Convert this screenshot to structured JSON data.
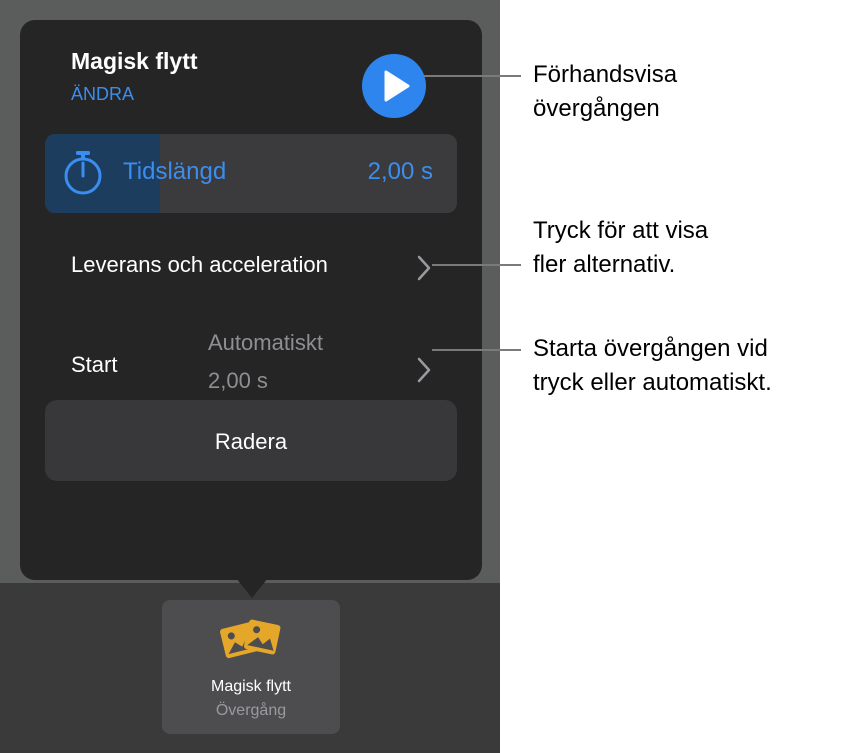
{
  "popover": {
    "title": "Magisk flytt",
    "change_label": "ÄNDRA",
    "play_icon": "play-icon",
    "duration": {
      "icon": "stopwatch-icon",
      "label": "Tidslängd",
      "value": "2,00 s",
      "fill_fraction": 0.28
    },
    "delivery": {
      "label": "Leverans och acceleration",
      "icon": "chevron-right-icon"
    },
    "start": {
      "label": "Start",
      "value_line1": "Automatiskt",
      "value_line2": "2,00 s",
      "icon": "chevron-right-icon"
    },
    "delete_label": "Radera"
  },
  "bottom_bar": {
    "thumb_icon": "photos-icon",
    "thumb_title": "Magisk flytt",
    "thumb_subtitle": "Övergång"
  },
  "callouts": [
    {
      "lines": [
        "Förhandsvisa",
        "övergången"
      ]
    },
    {
      "lines": [
        "Tryck för att visa",
        "fler alternativ."
      ]
    },
    {
      "lines": [
        "Starta övergången vid",
        "tryck eller automatiskt."
      ]
    }
  ],
  "colors": {
    "accent": "#2f85ee",
    "link": "#3a8ef0",
    "popover_bg": "#252526",
    "backdrop": "#5b5c5c",
    "toolbar_bg": "#3a3a3b",
    "icon_gold": "#e5a72a"
  }
}
